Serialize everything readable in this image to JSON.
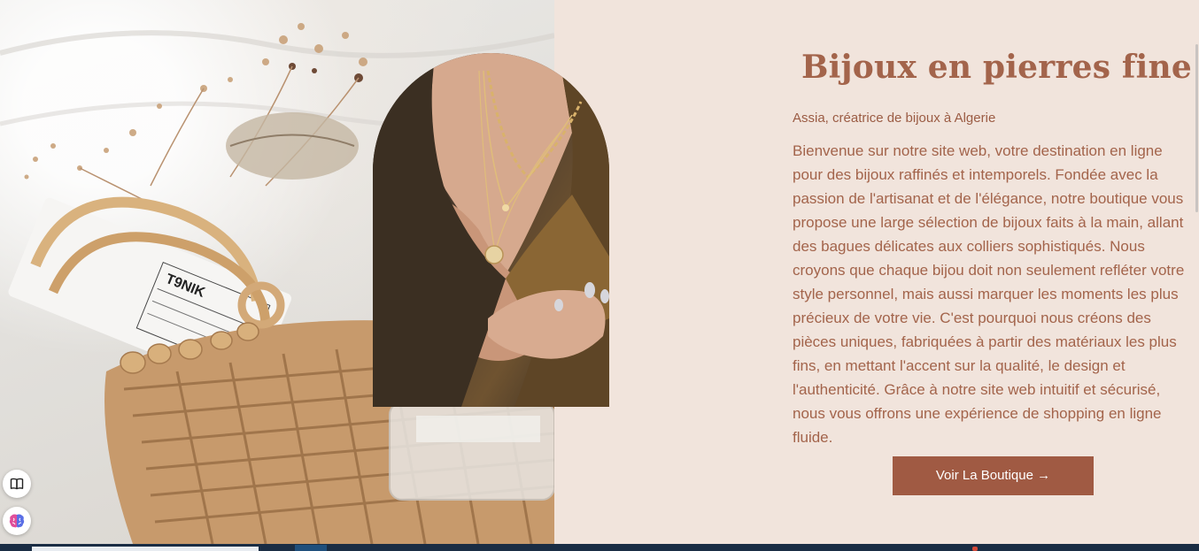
{
  "hero": {
    "title": "Bijoux en pierres fines",
    "subtitle": "Assia, créatrice de bijoux à Algerie",
    "description": "Bienvenue sur notre site web, votre destination en ligne pour des bijoux raffinés et intemporels. Fondée avec la passion de l'artisanat et de l'élégance, notre boutique vous propose une large sélection de bijoux faits à la main, allant des bagues délicates aux colliers sophistiqués. Nous croyons que chaque bijou doit non seulement refléter votre style personnel, mais aussi marquer les moments les plus précieux de votre vie. C'est pourquoi nous créons des pièces uniques, fabriquées à partir des matériaux les plus fins, en mettant l'accent sur la qualité, le design et l'authenticité. Grâce à notre site web intuitif et sécurisé, nous vous offrons une expérience de shopping en ligne fluide.",
    "cta_label": "Voir La Boutique →"
  },
  "photo_left": {
    "bottle_brand": "T9NIK"
  },
  "floating_buttons": {
    "top_icon": "book-icon",
    "bottom_icon": "brain-icon"
  },
  "colors": {
    "background": "#f1e4dc",
    "title": "#a3644b",
    "body_text": "#a3644b",
    "button": "#a05a43",
    "button_text": "#ffffff",
    "taskbar": "#1a2d44"
  }
}
